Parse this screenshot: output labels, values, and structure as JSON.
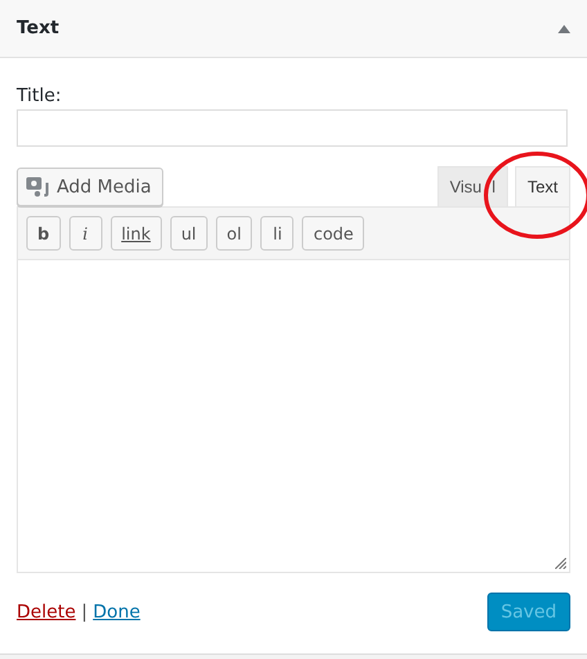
{
  "widget": {
    "title": "Text",
    "expanded": true
  },
  "title_field": {
    "label": "Title:"
  },
  "add_media": "Add Media",
  "editor_tabs": [
    {
      "label": "Visu l",
      "selected": false
    },
    {
      "label": "Text",
      "selected": true
    }
  ],
  "quicktags": [
    {
      "label": "b",
      "kind": "bold"
    },
    {
      "label": "i",
      "kind": "italic"
    },
    {
      "label": "link",
      "kind": "link"
    },
    {
      "label": "ul",
      "kind": "plain"
    },
    {
      "label": "ol",
      "kind": "plain"
    },
    {
      "label": "li",
      "kind": "plain"
    },
    {
      "label": "code",
      "kind": "plain"
    }
  ],
  "footer": {
    "delete": "Delete",
    "separator": "|",
    "done": "Done",
    "save": "Saved",
    "save_disabled": true
  },
  "annotation": {
    "kind": "circle",
    "color": "#e8141c"
  }
}
